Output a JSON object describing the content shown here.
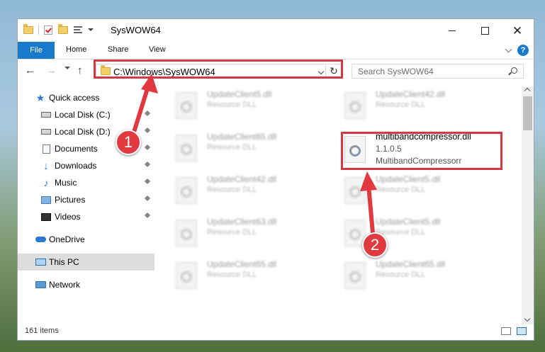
{
  "window": {
    "title": "SysWOW64"
  },
  "ribbon": {
    "tabs": [
      "File",
      "Home",
      "Share",
      "View"
    ],
    "help": "?"
  },
  "address": {
    "path": "C:\\Windows\\SysWOW64",
    "refresh_glyph": "↻"
  },
  "search": {
    "placeholder": "Search SysWOW64"
  },
  "nav": {
    "back": "←",
    "forward": "→",
    "up": "↑"
  },
  "sidebar": {
    "items": [
      {
        "label": "Quick access",
        "icon": "star-icon"
      },
      {
        "label": "Local Disk (C:)",
        "icon": "disk-icon"
      },
      {
        "label": "Local Disk (D:)",
        "icon": "disk-icon"
      },
      {
        "label": "Documents",
        "icon": "documents-icon"
      },
      {
        "label": "Downloads",
        "icon": "downloads-icon"
      },
      {
        "label": "Music",
        "icon": "music-icon"
      },
      {
        "label": "Pictures",
        "icon": "pictures-icon"
      },
      {
        "label": "Videos",
        "icon": "videos-icon"
      },
      {
        "label": "OneDrive",
        "icon": "cloud-icon"
      },
      {
        "label": "This PC",
        "icon": "computer-icon"
      },
      {
        "label": "Network",
        "icon": "network-icon"
      }
    ]
  },
  "files": [
    {
      "name": "UpdateClient5.dll",
      "type": "Resource DLL"
    },
    {
      "name": "UpdateClient42.dll",
      "type": "Resource DLL"
    },
    {
      "name": "UpdateClient65.dll",
      "type": "Resource DLL"
    },
    {
      "name": "multibandcompressor.dll",
      "version": "1.1.0.5",
      "type": "MultibandCompressorr"
    },
    {
      "name": "UpdateClient42.dll",
      "type": "Resource DLL"
    },
    {
      "name": "UpdateClient5.dll",
      "type": "Resource DLL"
    },
    {
      "name": "UpdateClient63.dll",
      "type": "Resource DLL"
    },
    {
      "name": "UpdateClient5.dll",
      "type": "Resource DLL"
    },
    {
      "name": "UpdateClient65.dll",
      "type": "Resource DLL"
    },
    {
      "name": "UpdateClient65.dll",
      "type": "Resource DLL"
    }
  ],
  "status": {
    "item_count": "161 items"
  },
  "annotations": {
    "step1": "1",
    "step2": "2",
    "highlight_color": "#d13a40"
  }
}
